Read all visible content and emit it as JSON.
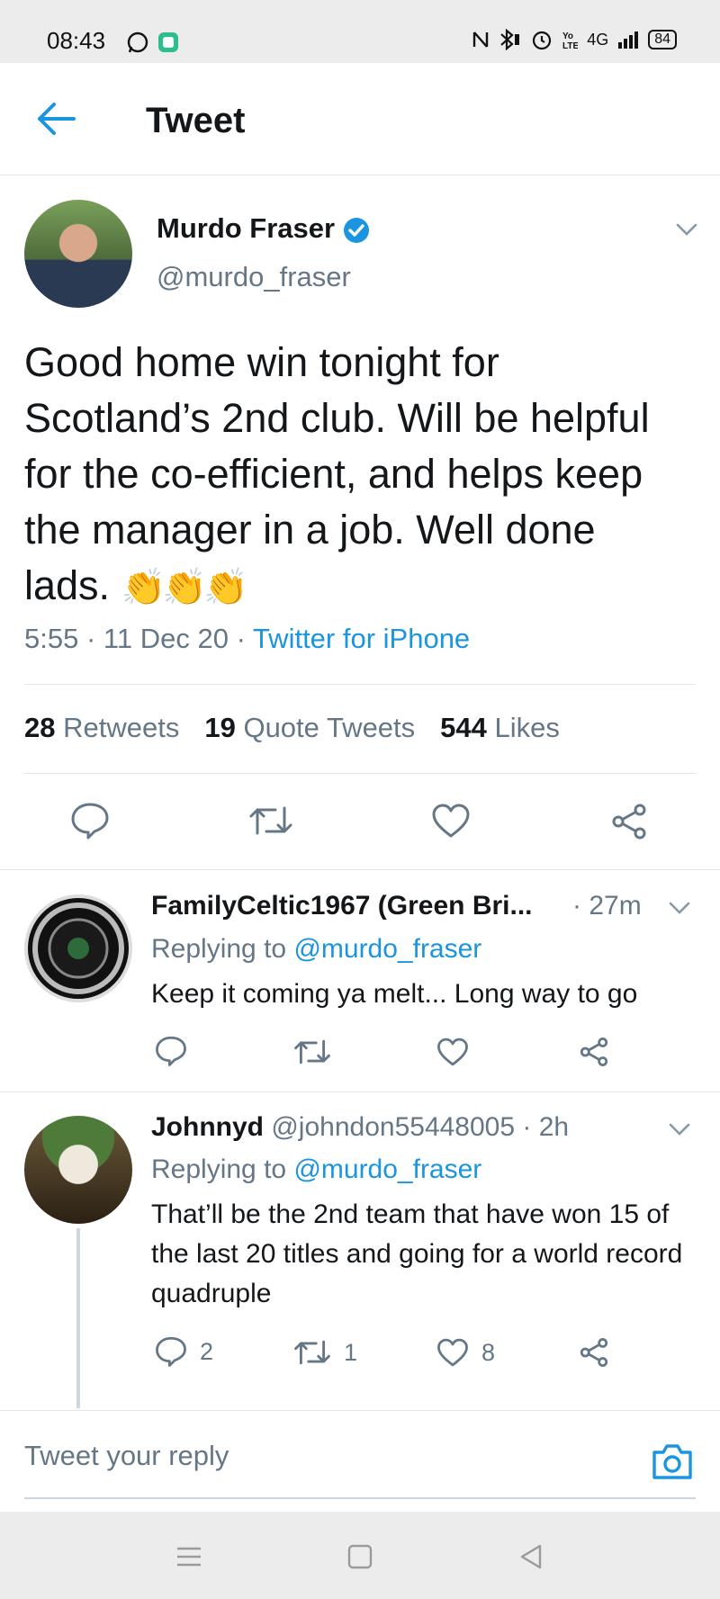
{
  "status_bar": {
    "time": "08:43",
    "network": "4G",
    "battery": "84",
    "icons": [
      "whatsapp-icon",
      "app-notification-icon",
      "nfc-icon",
      "bluetooth-icon",
      "alarm-icon",
      "volte-icon",
      "signal-icon",
      "battery-icon"
    ]
  },
  "header": {
    "title": "Tweet",
    "back_icon": "arrow-left-icon"
  },
  "main_tweet": {
    "name": "Murdo Fraser",
    "handle": "@murdo_fraser",
    "verified": true,
    "text": "Good home win tonight for Scotland’s 2nd club. Will be helpful for the co-efficient, and helps keep the manager in a job. Well done lads.",
    "emoji": "👏👏👏",
    "time": "5:55",
    "date": "11 Dec 20",
    "source": "Twitter for iPhone",
    "stats": {
      "retweets_count": "28",
      "retweets_label": "Retweets",
      "quotes_count": "19",
      "quotes_label": "Quote Tweets",
      "likes_count": "544",
      "likes_label": "Likes"
    }
  },
  "replies": [
    {
      "name": "FamilyCeltic1967 (Green Bri...",
      "handle": "",
      "time": "· 27m",
      "replying_prefix": "Replying to",
      "replying_to": "@murdo_fraser",
      "text": "Keep it coming ya melt... Long way to go",
      "reply_count": "",
      "retweet_count": "",
      "like_count": ""
    },
    {
      "name": "Johnnyd",
      "handle": "@johndon55448005",
      "time": "· 2h",
      "replying_prefix": "Replying to",
      "replying_to": "@murdo_fraser",
      "text": "That’ll be the 2nd team that have won 15 of the last 20 titles and going for a world record quadruple",
      "reply_count": "2",
      "retweet_count": "1",
      "like_count": "8"
    }
  ],
  "reply_box": {
    "placeholder": "Tweet your reply"
  },
  "colors": {
    "accent": "#1b95e0",
    "text": "#14171a",
    "muted": "#657786",
    "divider": "#e1e8ed"
  }
}
